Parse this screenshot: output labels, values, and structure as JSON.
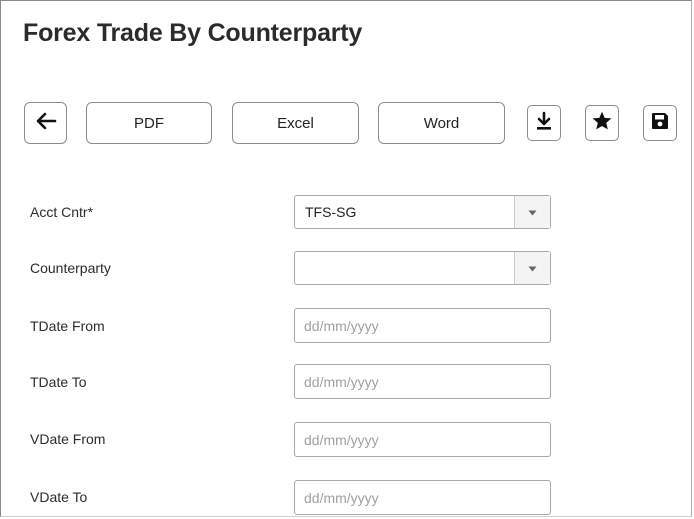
{
  "page": {
    "title": "Forex Trade By Counterparty"
  },
  "toolbar": {
    "back_icon": "arrow-left-icon",
    "pdf_label": "PDF",
    "excel_label": "Excel",
    "word_label": "Word",
    "download_icon": "download-icon",
    "favorite_icon": "star-icon",
    "save_icon": "floppy-disk-icon"
  },
  "form": {
    "acct_cntr": {
      "label": "Acct Cntr*",
      "value": "TFS-SG"
    },
    "counterparty": {
      "label": "Counterparty",
      "value": ""
    },
    "tdate_from": {
      "label": "TDate From",
      "placeholder": "dd/mm/yyyy"
    },
    "tdate_to": {
      "label": "TDate To",
      "placeholder": "dd/mm/yyyy"
    },
    "vdate_from": {
      "label": "VDate From",
      "placeholder": "dd/mm/yyyy"
    },
    "vdate_to": {
      "label": "VDate To",
      "placeholder": "dd/mm/yyyy"
    }
  }
}
